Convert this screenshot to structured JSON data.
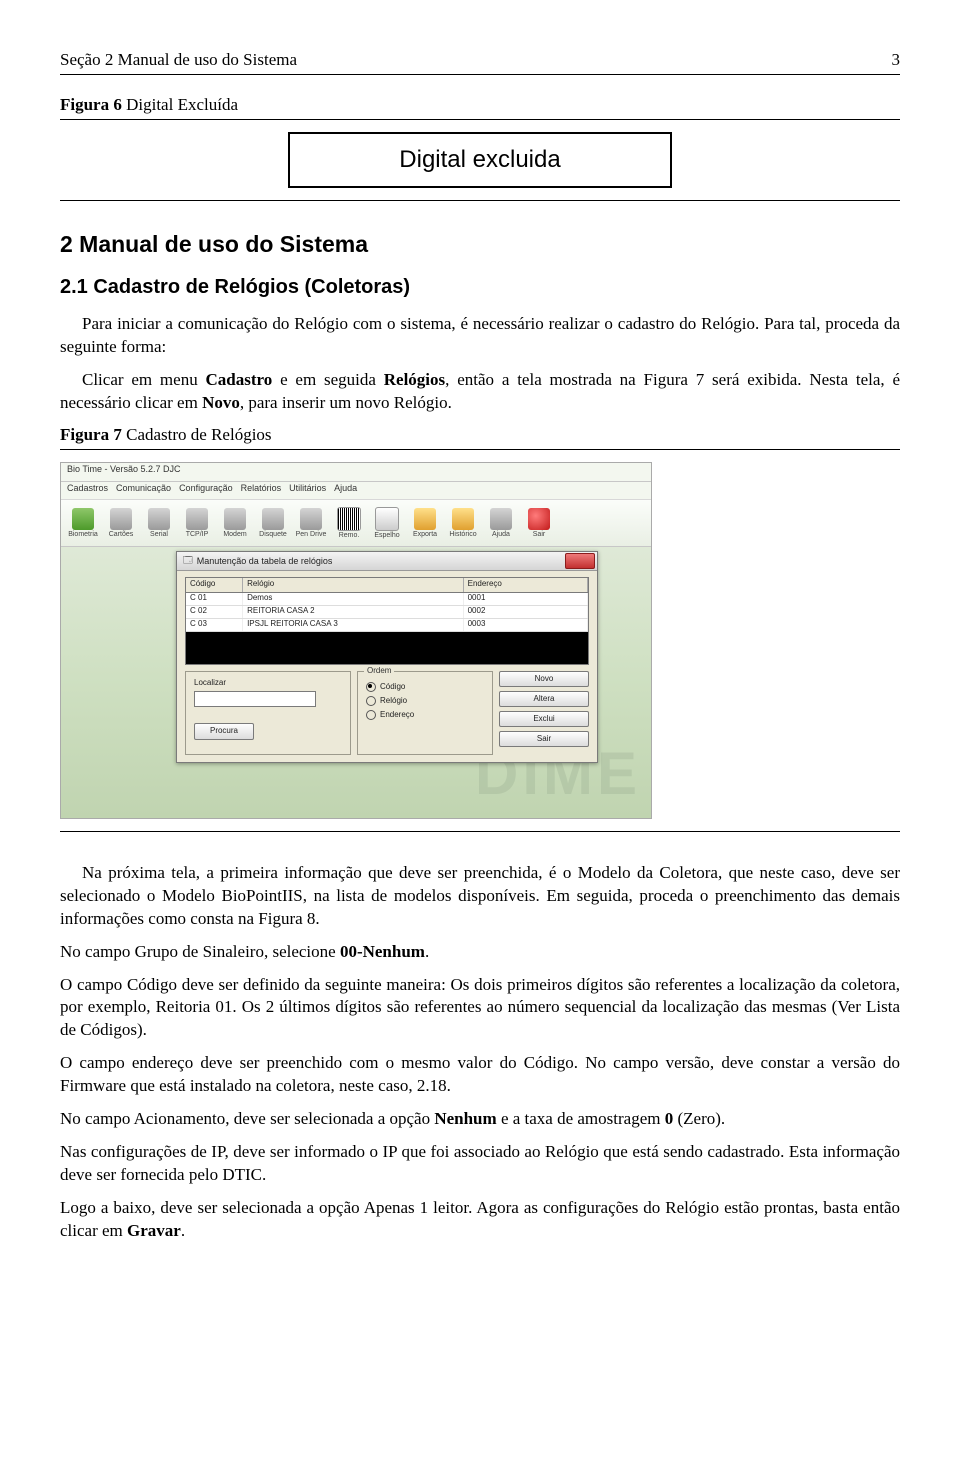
{
  "header": {
    "left": "Seção 2   Manual de uso do Sistema",
    "right": "3"
  },
  "figure6": {
    "label": "Figura 6 Digital Excluída",
    "box_text": "Digital excluida"
  },
  "section2": {
    "number_title": "2   Manual de uso do Sistema",
    "sub_title": "2.1   Cadastro de Relógios (Coletoras)",
    "para1": "Para iniciar a comunicação do Relógio com o sistema, é necessário realizar o cadastro do Relógio. Para tal, proceda da seguinte forma:",
    "para2_a": "Clicar em menu ",
    "para2_b": "Cadastro",
    "para2_c": " e em seguida ",
    "para2_d": "Relógios",
    "para2_e": ", então a tela mostrada na Figura 7 será exibida. Nesta tela, é necessário clicar em ",
    "para2_f": "Novo",
    "para2_g": ", para inserir um novo Relógio."
  },
  "figure7": {
    "label": "Figura 7 Cadastro de Relógios"
  },
  "screenshot": {
    "app_title": "Bio Time - Versão 5.2.7 DJC",
    "menus": [
      "Cadastros",
      "Comunicação",
      "Configuração",
      "Relatórios",
      "Utilitários",
      "Ajuda"
    ],
    "toolbar": [
      "Biometria",
      "Cartões",
      "Serial",
      "TCP/IP",
      "Modem",
      "Disquete",
      "Pen Drive",
      "Remo.",
      "Espelho",
      "Exporta",
      "Histórico",
      "Ajuda",
      "Sair"
    ],
    "dialog_title": "Manutenção da tabela de relógios",
    "columns": [
      "Código",
      "Relógio",
      "Endereço"
    ],
    "rows": [
      {
        "codigo": "C 01",
        "relogio": "Demos",
        "end": "0001"
      },
      {
        "codigo": "C 02",
        "relogio": "REITORIA CASA 2",
        "end": "0002"
      },
      {
        "codigo": "C 03",
        "relogio": "IPSJL REITORIA CASA 3",
        "end": "0003"
      }
    ],
    "localizar_label": "Localizar",
    "procura_btn": "Procura",
    "ordem_label": "Ordem",
    "radios": [
      "Código",
      "Relógio",
      "Endereço"
    ],
    "buttons": [
      "Novo",
      "Altera",
      "Exclui",
      "Sair"
    ],
    "watermark": "DIME"
  },
  "body_after": {
    "p1_a": "Na próxima tela, a primeira informação que deve ser preenchida, é o Modelo da Coletora, que neste caso, deve ser selecionado o Modelo BioPointIIS, na lista de modelos disponíveis. Em seguida, proceda o preenchimento das demais informações como consta na Figura 8.",
    "p2_a": "No campo Grupo de Sinaleiro, selecione ",
    "p2_b": "00-Nenhum",
    "p2_c": ".",
    "p3": "O campo Código deve ser definido da seguinte maneira: Os dois primeiros dígitos são referentes a localização da coletora, por exemplo, Reitoria 01. Os 2 últimos dígitos são referentes ao número sequencial da localização das mesmas (Ver Lista de Códigos).",
    "p4": "O campo endereço deve ser preenchido com o mesmo valor do Código. No campo versão, deve constar a versão do Firmware que está instalado na coletora, neste caso, 2.18.",
    "p5_a": "No campo Acionamento, deve ser selecionada a opção ",
    "p5_b": "Nenhum",
    "p5_c": " e a taxa de amostragem ",
    "p5_d": "0",
    "p5_e": " (Zero).",
    "p6": "Nas configurações de IP, deve ser informado o IP que foi associado ao Relógio que está sendo cadastrado. Esta informação deve ser fornecida pelo DTIC.",
    "p7_a": "Logo a baixo, deve ser selecionada a opção Apenas 1 leitor.  Agora as configurações do Relógio estão prontas, basta então clicar em ",
    "p7_b": "Gravar",
    "p7_c": "."
  }
}
